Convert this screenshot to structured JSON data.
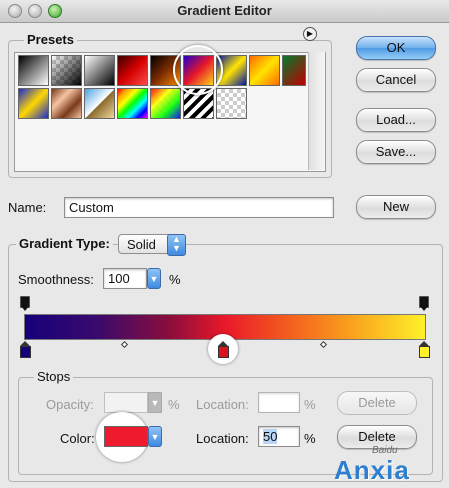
{
  "window": {
    "title": "Gradient Editor"
  },
  "presets": {
    "legend": "Presets",
    "menu_icon": "circle-arrow-icon",
    "rows": [
      [
        "black-white",
        "transparent-black",
        "black-white-2",
        "red-dark",
        "dark-orange",
        "blue-red-yellow",
        "yellow-blue",
        "orange-yellow",
        "green-red",
        "multicolor"
      ],
      [
        "blue-yellow",
        "copper",
        "chrome",
        "rainbow",
        "rainbow-transparent",
        "stripes",
        "transparent"
      ]
    ]
  },
  "buttons": {
    "ok": "OK",
    "cancel": "Cancel",
    "load": "Load...",
    "save": "Save...",
    "new": "New"
  },
  "name": {
    "label": "Name:",
    "value": "Custom"
  },
  "gradient_type": {
    "label": "Gradient Type:",
    "value": "Solid"
  },
  "smoothness": {
    "label": "Smoothness:",
    "value": "100",
    "unit": "%"
  },
  "gradient": {
    "colors": [
      "#16007a",
      "#8a0d3c",
      "#e9182a",
      "#f99a1c",
      "#fff12a"
    ]
  },
  "stops": {
    "legend": "Stops",
    "opacity_label": "Opacity:",
    "opacity_value": "",
    "opacity_unit": "%",
    "location_label_1": "Location:",
    "location_value_1": "",
    "location_unit_1": "%",
    "delete_label_1": "Delete",
    "color_label": "Color:",
    "color_value": "#ee1b2e",
    "location_label_2": "Location:",
    "location_value_2": "50",
    "location_unit_2": "%",
    "delete_label_2": "Delete"
  },
  "watermark": {
    "text": "Anxia",
    "sub": "Baidu"
  }
}
